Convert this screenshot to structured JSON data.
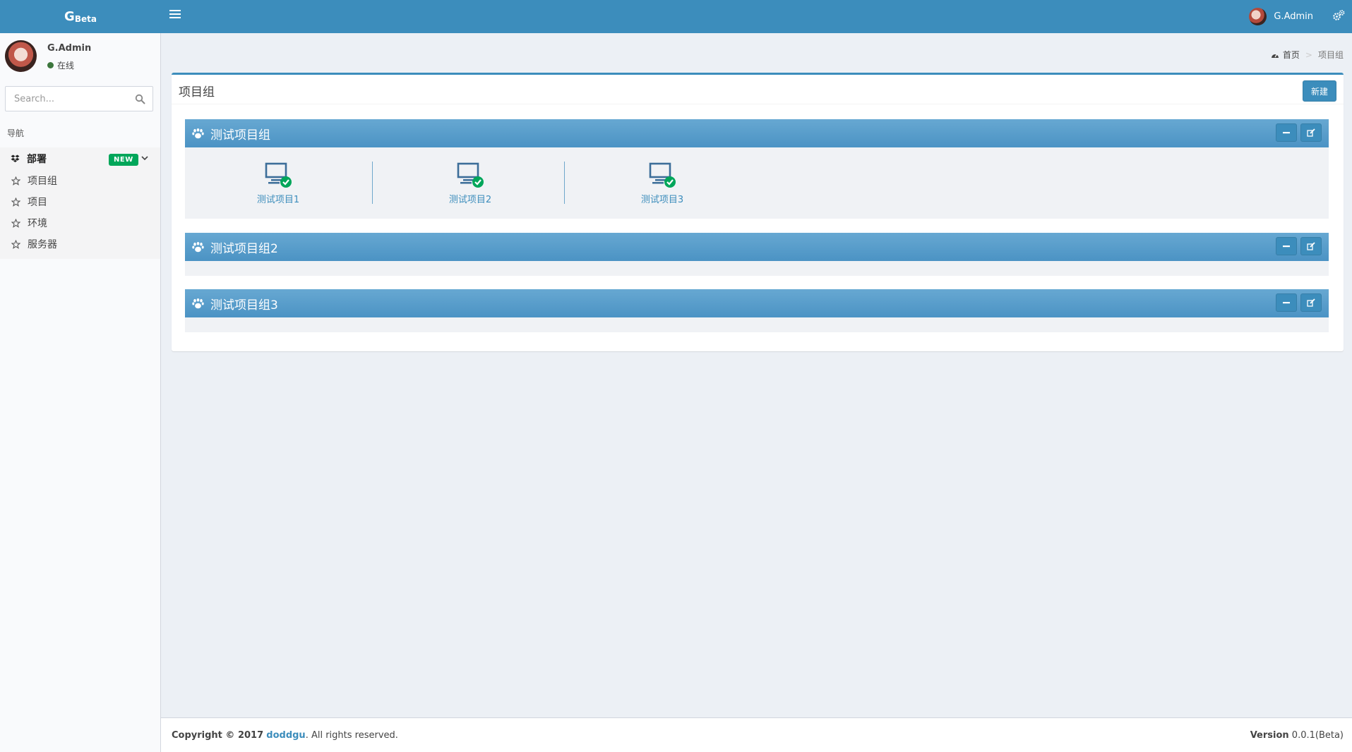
{
  "header": {
    "logo_main": "G",
    "logo_sub": "Beta",
    "user_name": "G.Admin"
  },
  "sidebar": {
    "user": {
      "name": "G.Admin",
      "status": "在线"
    },
    "search": {
      "placeholder": "Search..."
    },
    "nav_header": "导航",
    "tree": {
      "label": "部署",
      "badge": "NEW",
      "items": [
        {
          "label": "项目组"
        },
        {
          "label": "项目"
        },
        {
          "label": "环境"
        },
        {
          "label": "服务器"
        }
      ]
    }
  },
  "breadcrumb": {
    "home": "首页",
    "current": "项目组"
  },
  "main": {
    "title": "项目组",
    "new_button": "新建",
    "groups": [
      {
        "title": "测试项目组",
        "projects": [
          {
            "label": "测试项目1"
          },
          {
            "label": "测试项目2"
          },
          {
            "label": "测试项目3"
          }
        ]
      },
      {
        "title": "测试项目组2",
        "projects": []
      },
      {
        "title": "测试项目组3",
        "projects": []
      }
    ]
  },
  "footer": {
    "copyright_prefix": "Copyright © 2017",
    "company": "doddgu",
    "copyright_suffix": ". All rights reserved.",
    "version_label": "Version",
    "version_value": "0.0.1(Beta)"
  },
  "colors": {
    "primary": "#3c8dbc",
    "group_header": "#5a9fcf",
    "online": "#3c763d",
    "badge_new": "#00a65a",
    "project_ok": "#00a65a"
  },
  "icons": {
    "menu": "hamburger-icon",
    "settings": "gears-icon",
    "search": "search-icon",
    "tree": "dropbox-icon",
    "sub_item": "star-outline-icon",
    "group": "paw-icon",
    "project": "desktop-check-icon",
    "collapse": "minus-icon",
    "edit": "edit-icon",
    "home": "dashboard-icon"
  }
}
